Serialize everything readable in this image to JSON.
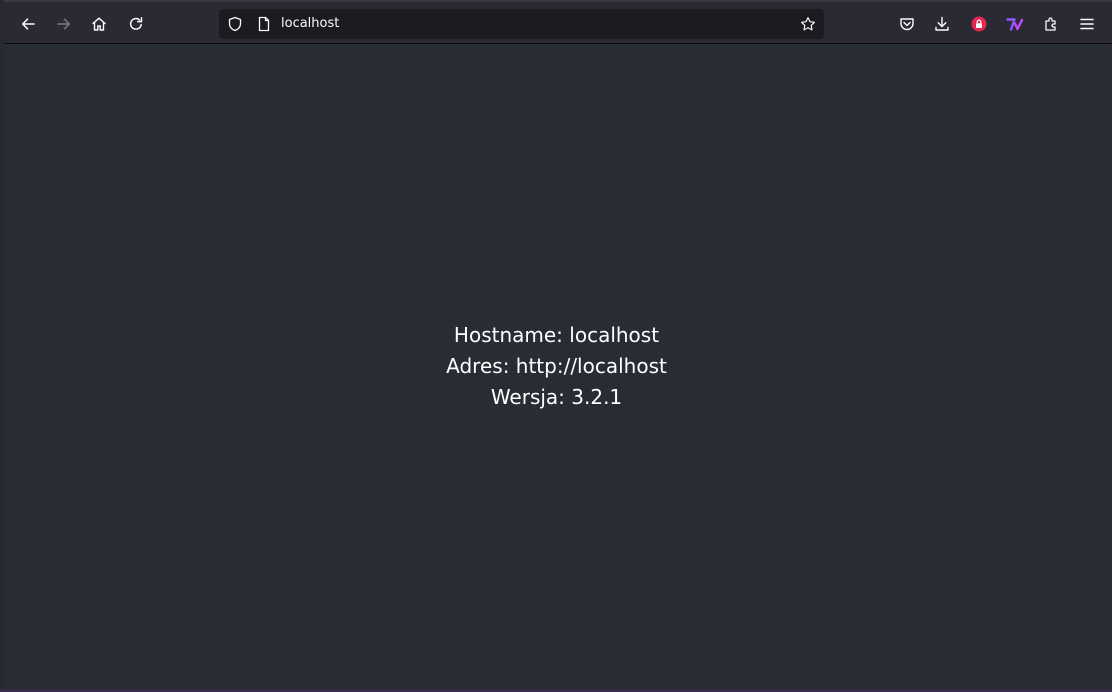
{
  "browser": {
    "url": "localhost",
    "icons": {
      "back": "back-arrow-icon",
      "forward": "forward-arrow-icon",
      "home": "home-icon",
      "reload": "reload-icon",
      "tracking": "shield-icon",
      "page": "page-icon",
      "bookmark": "star-icon",
      "pocket": "pocket-icon",
      "downloads": "download-icon",
      "ext_red": "red-lock-extension-icon",
      "ext_purple": "purple-extension-icon",
      "extensions": "puzzle-icon",
      "menu": "hamburger-menu-icon"
    },
    "colors": {
      "toolbar": "#2b2a33",
      "urlbar": "#1c1b22",
      "content": "#282c35",
      "red_ext": "#e22850",
      "purple_ext": "#9059ff"
    }
  },
  "page": {
    "hostname_line": "Hostname: localhost",
    "address_line": "Adres: http://localhost",
    "version_line": "Wersja: 3.2.1"
  }
}
